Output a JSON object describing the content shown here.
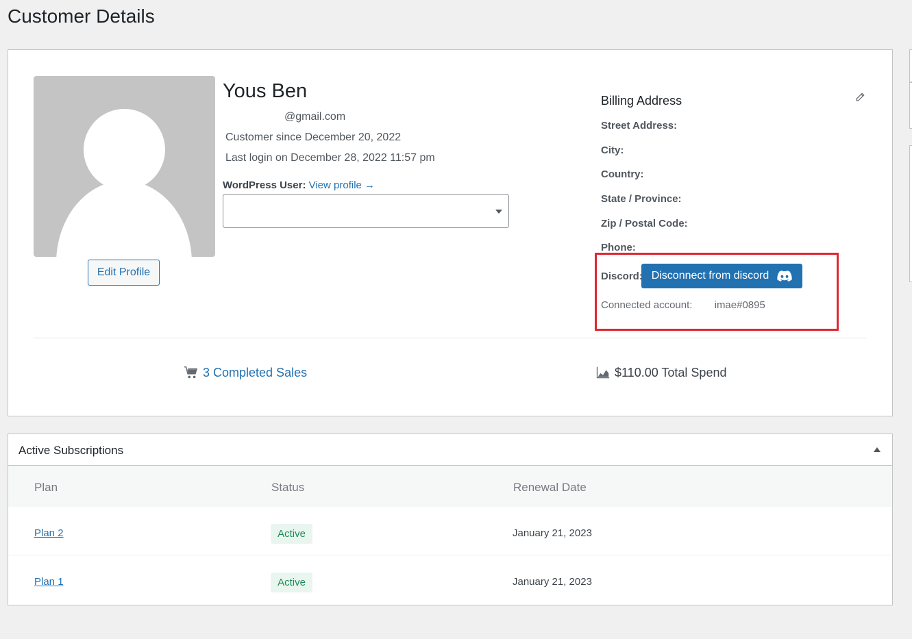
{
  "page": {
    "title": "Customer Details"
  },
  "customer": {
    "name": "Yous Ben",
    "email": "@gmail.com",
    "since": "Customer since December 20, 2022",
    "last_login": "Last login on December 28, 2022 11:57 pm",
    "edit_profile_label": "Edit Profile",
    "wp_user_label": "WordPress User:",
    "view_profile_label": "View profile →"
  },
  "billing": {
    "title": "Billing Address",
    "rows": [
      "Street Address:",
      "City:",
      "Country:",
      "State / Province:",
      "Zip / Postal Code:",
      "Phone:"
    ],
    "discord_label": "Discord:",
    "discord_button": "Disconnect from discord",
    "connected_label": "Connected account:",
    "connected_value": "imae#0895"
  },
  "stats": {
    "sales": "3 Completed Sales",
    "spend": "$110.00 Total Spend"
  },
  "subscriptions": {
    "title": "Active Subscriptions",
    "columns": [
      "Plan",
      "Status",
      "Renewal Date"
    ],
    "rows": [
      {
        "plan": "Plan 2",
        "status": "Active",
        "renewal": "January 21, 2023"
      },
      {
        "plan": "Plan 1",
        "status": "Active",
        "renewal": "January 21, 2023"
      }
    ]
  },
  "colors": {
    "accent": "#2271b1",
    "highlight": "#e02531",
    "status_active_bg": "#e9f6ef",
    "status_active_text": "#1f8a56"
  }
}
